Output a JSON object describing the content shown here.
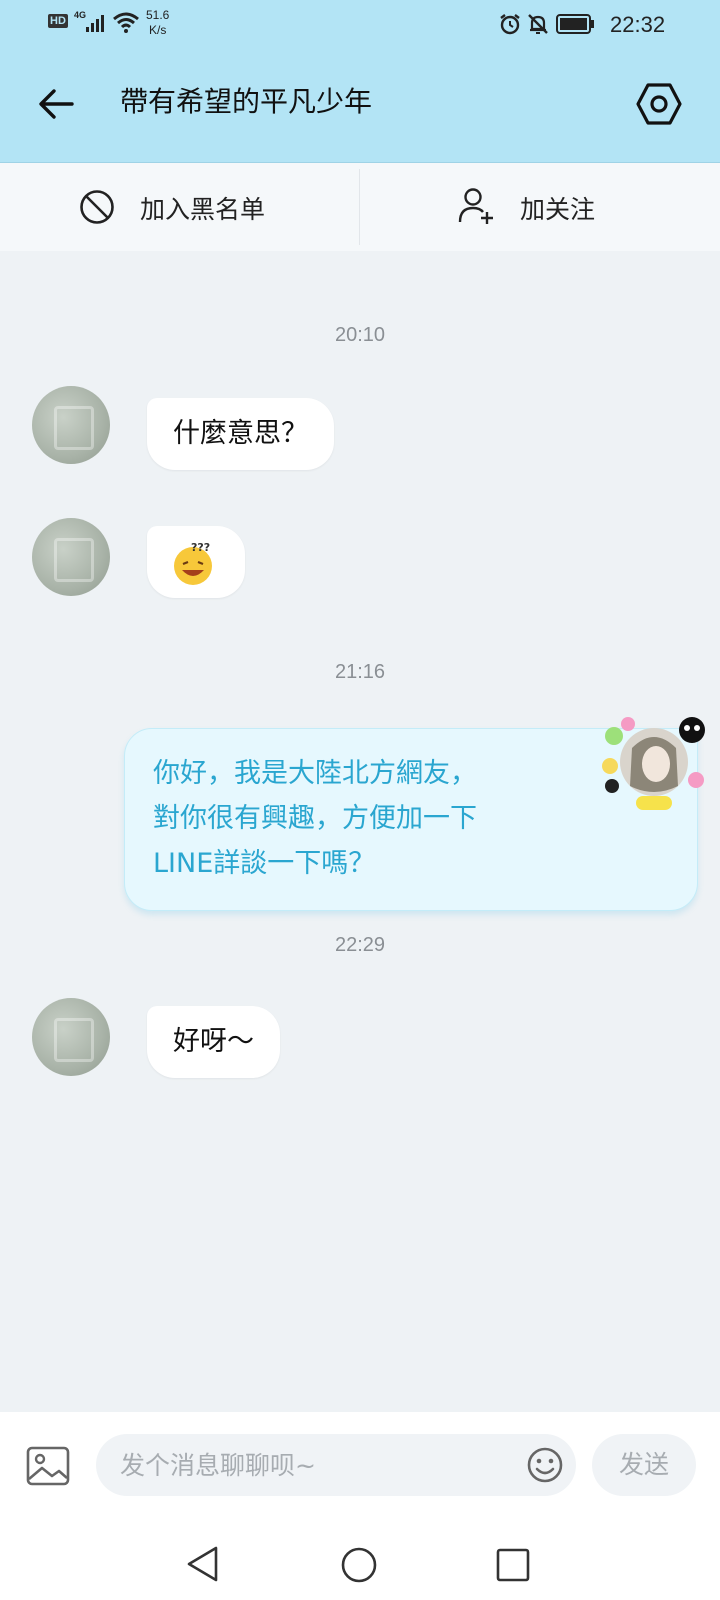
{
  "status_bar": {
    "hd": "HD",
    "network": "4G",
    "speed_value": "51.6",
    "speed_unit": "K/s",
    "time": "22:32",
    "icons": [
      "signal-icon",
      "wifi-icon",
      "alarm-icon",
      "bell-off-icon",
      "battery-icon"
    ]
  },
  "header": {
    "title": "帶有希望的平凡少年",
    "back_icon": "back-arrow-icon",
    "settings_icon": "settings-icon"
  },
  "actions": {
    "block_label": "加入黑名单",
    "follow_label": "加关注"
  },
  "messages": [
    {
      "type": "time",
      "text": "20:10"
    },
    {
      "type": "incoming",
      "text": "什麼意思？"
    },
    {
      "type": "incoming",
      "emoji": "confused-emoji"
    },
    {
      "type": "time",
      "text": "21:16"
    },
    {
      "type": "outgoing",
      "lines": [
        "你好，我是大陸北方網友，",
        "對你很有興趣，方便加一下",
        "LINE詳談一下嗎？"
      ]
    },
    {
      "type": "time",
      "text": "22:29"
    },
    {
      "type": "incoming",
      "text": "好呀～"
    }
  ],
  "composer": {
    "placeholder": "发个消息聊聊呗~",
    "send_label": "发送"
  },
  "colors": {
    "header_bg": "#b3e4f5",
    "outgoing_text": "#2aa6d0",
    "outgoing_bg": "#e6f8fe",
    "page_bg": "#eef2f5"
  }
}
